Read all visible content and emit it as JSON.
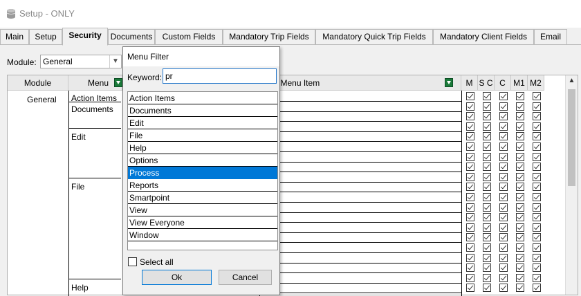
{
  "window": {
    "title": "Setup - ONLY",
    "icon": "database-icon"
  },
  "tabs": [
    {
      "label": "Main"
    },
    {
      "label": "Setup"
    },
    {
      "label": "Security",
      "active": true
    },
    {
      "label": "Documents"
    },
    {
      "label": "Custom Fields"
    },
    {
      "label": "Mandatory Trip Fields"
    },
    {
      "label": "Mandatory Quick Trip Fields"
    },
    {
      "label": "Mandatory Client Fields"
    },
    {
      "label": "Email"
    }
  ],
  "module": {
    "label": "Module:",
    "value": "General"
  },
  "grid": {
    "headers": {
      "module": "Module",
      "menu": "Menu",
      "submenu": "Sub Menu Item",
      "m": "M",
      "sc": "S C",
      "c": "C",
      "m1": "M1",
      "m2": "M2"
    },
    "module_value": "General",
    "menu_items": [
      "Action Items",
      "Documents",
      "Edit",
      "File",
      "Help"
    ]
  },
  "popup": {
    "title": "Menu Filter",
    "keyword_label": "Keyword:",
    "keyword_value": "pr",
    "items": [
      "Action Items",
      "Documents",
      "Edit",
      "File",
      "Help",
      "Options",
      "Process",
      "Reports",
      "Smartpoint",
      "View",
      "View Everyone",
      "Window"
    ],
    "selected": "Process",
    "select_all": "Select all",
    "ok": "Ok",
    "cancel": "Cancel"
  }
}
